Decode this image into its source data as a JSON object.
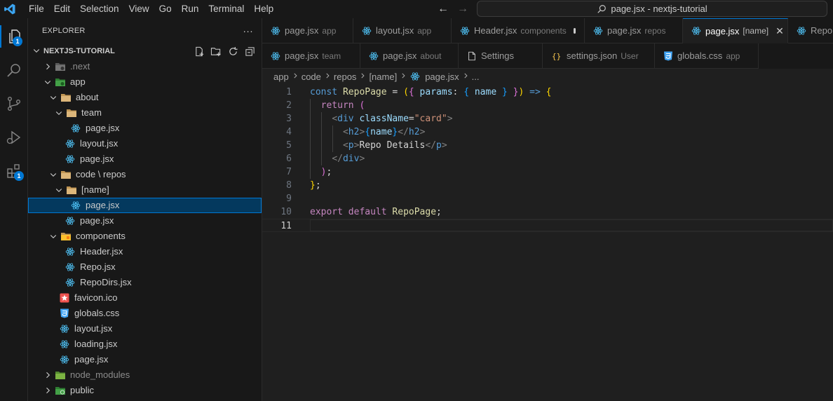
{
  "menu": [
    "File",
    "Edit",
    "Selection",
    "View",
    "Go",
    "Run",
    "Terminal",
    "Help"
  ],
  "command_center": "page.jsx - nextjs-tutorial",
  "activity_badges": {
    "explorer": "1",
    "extensions": "1"
  },
  "sidebar": {
    "title": "EXPLORER",
    "more_label": "···",
    "section": "NEXTJS-TUTORIAL",
    "tree": [
      {
        "label": ".next",
        "depth": 0,
        "kind": "folder",
        "open": false,
        "icon": "folder-next-icon",
        "dim": true
      },
      {
        "label": "app",
        "depth": 0,
        "kind": "folder",
        "open": true,
        "icon": "folder-app-icon"
      },
      {
        "label": "about",
        "depth": 1,
        "kind": "folder",
        "open": true,
        "icon": "folder-icon"
      },
      {
        "label": "team",
        "depth": 2,
        "kind": "folder",
        "open": true,
        "icon": "folder-icon"
      },
      {
        "label": "page.jsx",
        "depth": 3,
        "kind": "file",
        "icon": "react-icon"
      },
      {
        "label": "layout.jsx",
        "depth": 2,
        "kind": "file",
        "icon": "react-icon"
      },
      {
        "label": "page.jsx",
        "depth": 2,
        "kind": "file",
        "icon": "react-icon"
      },
      {
        "label": "code \\ repos",
        "depth": 1,
        "kind": "folder",
        "open": true,
        "icon": "folder-icon"
      },
      {
        "label": "[name]",
        "depth": 2,
        "kind": "folder",
        "open": true,
        "icon": "folder-icon"
      },
      {
        "label": "page.jsx",
        "depth": 3,
        "kind": "file",
        "icon": "react-icon",
        "selected": true
      },
      {
        "label": "page.jsx",
        "depth": 2,
        "kind": "file",
        "icon": "react-icon"
      },
      {
        "label": "components",
        "depth": 1,
        "kind": "folder",
        "open": true,
        "icon": "folder-components-icon"
      },
      {
        "label": "Header.jsx",
        "depth": 2,
        "kind": "file",
        "icon": "react-icon"
      },
      {
        "label": "Repo.jsx",
        "depth": 2,
        "kind": "file",
        "icon": "react-icon"
      },
      {
        "label": "RepoDirs.jsx",
        "depth": 2,
        "kind": "file",
        "icon": "react-icon"
      },
      {
        "label": "favicon.ico",
        "depth": 1,
        "kind": "file",
        "icon": "favicon-icon"
      },
      {
        "label": "globals.css",
        "depth": 1,
        "kind": "file",
        "icon": "css-icon"
      },
      {
        "label": "layout.jsx",
        "depth": 1,
        "kind": "file",
        "icon": "react-icon"
      },
      {
        "label": "loading.jsx",
        "depth": 1,
        "kind": "file",
        "icon": "react-icon"
      },
      {
        "label": "page.jsx",
        "depth": 1,
        "kind": "file",
        "icon": "react-icon"
      },
      {
        "label": "node_modules",
        "depth": 0,
        "kind": "folder",
        "open": false,
        "icon": "folder-node-icon",
        "dim": true
      },
      {
        "label": "public",
        "depth": 0,
        "kind": "folder",
        "open": false,
        "icon": "folder-public-icon"
      }
    ]
  },
  "tabs_row1": [
    {
      "name": "page.jsx",
      "desc": "app",
      "icon": "react-icon"
    },
    {
      "name": "layout.jsx",
      "desc": "app",
      "icon": "react-icon"
    },
    {
      "name": "Header.jsx",
      "desc": "components",
      "icon": "react-icon",
      "dirty": true
    },
    {
      "name": "page.jsx",
      "desc": "repos",
      "icon": "react-icon"
    },
    {
      "name": "page.jsx",
      "desc": "[name]",
      "icon": "react-icon",
      "active": true
    },
    {
      "name": "Repo",
      "desc": "",
      "icon": "react-icon"
    }
  ],
  "tabs_row2": [
    {
      "name": "page.jsx",
      "desc": "team",
      "icon": "react-icon"
    },
    {
      "name": "page.jsx",
      "desc": "about",
      "icon": "react-icon"
    },
    {
      "name": "Settings",
      "desc": "",
      "icon": "file-icon"
    },
    {
      "name": "settings.json",
      "desc": "User",
      "icon": "json-icon"
    },
    {
      "name": "globals.css",
      "desc": "app",
      "icon": "css-icon"
    }
  ],
  "breadcrumb": [
    "app",
    "code",
    "repos",
    "[name]",
    "page.jsx",
    "..."
  ],
  "code_lines": [
    [
      [
        "kw",
        "const "
      ],
      [
        "fn",
        "RepoPage"
      ],
      [
        "punc",
        " = "
      ],
      [
        "br1",
        "("
      ],
      [
        "br2",
        "{"
      ],
      [
        "var",
        " params"
      ],
      [
        "punc",
        ": "
      ],
      [
        "br3",
        "{"
      ],
      [
        "var",
        " name "
      ],
      [
        "br3",
        "}"
      ],
      [
        "br2",
        " }"
      ],
      [
        "br1",
        ")"
      ],
      [
        "kw",
        " =>"
      ],
      [
        "punc",
        " "
      ],
      [
        "br1",
        "{"
      ]
    ],
    [
      [
        "punc",
        "  "
      ],
      [
        "kw2",
        "return"
      ],
      [
        "punc",
        " "
      ],
      [
        "br2",
        "("
      ]
    ],
    [
      [
        "punc",
        "    "
      ],
      [
        "tagb",
        "<"
      ],
      [
        "tag",
        "div"
      ],
      [
        "attr",
        " className"
      ],
      [
        "punc",
        "="
      ],
      [
        "str",
        "\"card\""
      ],
      [
        "tagb",
        ">"
      ]
    ],
    [
      [
        "punc",
        "      "
      ],
      [
        "tagb",
        "<"
      ],
      [
        "tag",
        "h2"
      ],
      [
        "tagb",
        ">"
      ],
      [
        "br3",
        "{"
      ],
      [
        "var",
        "name"
      ],
      [
        "br3",
        "}"
      ],
      [
        "tagb",
        "</"
      ],
      [
        "tag",
        "h2"
      ],
      [
        "tagb",
        ">"
      ]
    ],
    [
      [
        "punc",
        "      "
      ],
      [
        "tagb",
        "<"
      ],
      [
        "tag",
        "p"
      ],
      [
        "tagb",
        ">"
      ],
      [
        "txt",
        "Repo Details"
      ],
      [
        "tagb",
        "</"
      ],
      [
        "tag",
        "p"
      ],
      [
        "tagb",
        ">"
      ]
    ],
    [
      [
        "punc",
        "    "
      ],
      [
        "tagb",
        "</"
      ],
      [
        "tag",
        "div"
      ],
      [
        "tagb",
        ">"
      ]
    ],
    [
      [
        "punc",
        "  "
      ],
      [
        "br2",
        ")"
      ],
      [
        "punc",
        ";"
      ]
    ],
    [
      [
        "br1",
        "}"
      ],
      [
        "punc",
        ";"
      ]
    ],
    [],
    [
      [
        "kw2",
        "export"
      ],
      [
        "punc",
        " "
      ],
      [
        "kw2",
        "default"
      ],
      [
        "punc",
        " "
      ],
      [
        "fn",
        "RepoPage"
      ],
      [
        "punc",
        ";"
      ]
    ],
    []
  ],
  "current_line": 11,
  "colors": {
    "accent": "#0078d4",
    "bg": "#1f1f1f",
    "sidebar": "#181818"
  }
}
